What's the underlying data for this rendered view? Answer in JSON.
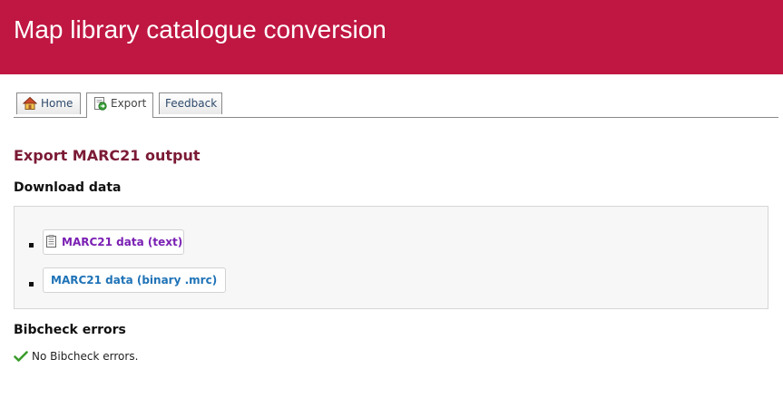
{
  "header": {
    "title": "Map library catalogue conversion"
  },
  "tabs": [
    {
      "label": "Home",
      "icon": "home-icon"
    },
    {
      "label": "Export",
      "icon": "export-icon",
      "active": true
    },
    {
      "label": "Feedback"
    }
  ],
  "main": {
    "section_title": "Export MARC21 output",
    "download": {
      "heading": "Download data",
      "links": [
        {
          "label": "MARC21 data (text)",
          "icon": "document-icon",
          "color": "#7a1fb3"
        },
        {
          "label": "MARC21 data (binary .mrc)",
          "color": "#1f73b7"
        }
      ]
    },
    "bibcheck": {
      "heading": "Bibcheck errors",
      "message": "No Bibcheck errors.",
      "icon": "checkmark-icon"
    }
  },
  "colors": {
    "header_bg": "#bf1742",
    "section_title": "#7b1a35"
  }
}
